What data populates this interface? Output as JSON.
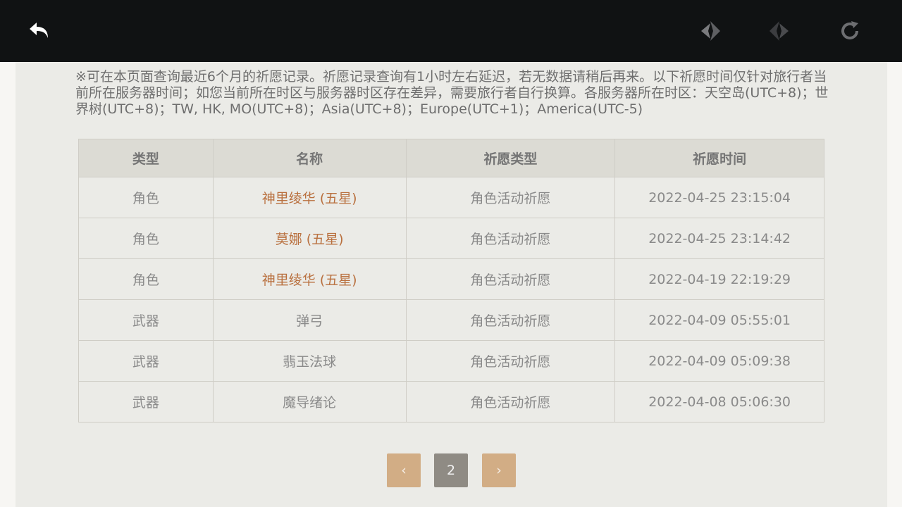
{
  "toolbar": {
    "back_icon": "back-arrow-icon",
    "prev_icon": "prev-diamond-icon",
    "next_icon": "next-diamond-icon",
    "refresh_icon": "refresh-icon"
  },
  "notice": "※可在本页面查询最近6个月的祈愿记录。祈愿记录查询有1小时左右延迟，若无数据请稍后再来。以下祈愿时间仅针对旅行者当前所在服务器时间；如您当前所在时区与服务器时区存在差异，需要旅行者自行换算。各服务器所在时区：天空岛(UTC+8)；世界树(UTC+8)；TW, HK, MO(UTC+8)；Asia(UTC+8)；Europe(UTC+1)；America(UTC-5)",
  "table": {
    "headers": [
      "类型",
      "名称",
      "祈愿类型",
      "祈愿时间"
    ],
    "rows": [
      {
        "type": "角色",
        "name": "神里绫华 (五星)",
        "wish_type": "角色活动祈愿",
        "time": "2022-04-25 23:15:04"
      },
      {
        "type": "角色",
        "name": "莫娜 (五星)",
        "wish_type": "角色活动祈愿",
        "time": "2022-04-25 23:14:42"
      },
      {
        "type": "角色",
        "name": "神里绫华 (五星)",
        "wish_type": "角色活动祈愿",
        "time": "2022-04-19 22:19:29"
      },
      {
        "type": "武器",
        "name": "弹弓",
        "wish_type": "角色活动祈愿",
        "time": "2022-04-09 05:55:01"
      },
      {
        "type": "武器",
        "name": "翡玉法球",
        "wish_type": "角色活动祈愿",
        "time": "2022-04-09 05:09:38"
      },
      {
        "type": "武器",
        "name": "魔导绪论",
        "wish_type": "角色活动祈愿",
        "time": "2022-04-08 05:06:30"
      }
    ]
  },
  "pagination": {
    "prev_label": "‹",
    "current_page": "2",
    "next_label": "›"
  },
  "colors": {
    "top_bar": "#101213",
    "five_star_text": "#b9703f",
    "pager_button": "#d2ad85",
    "pager_current": "#8f8b84"
  }
}
